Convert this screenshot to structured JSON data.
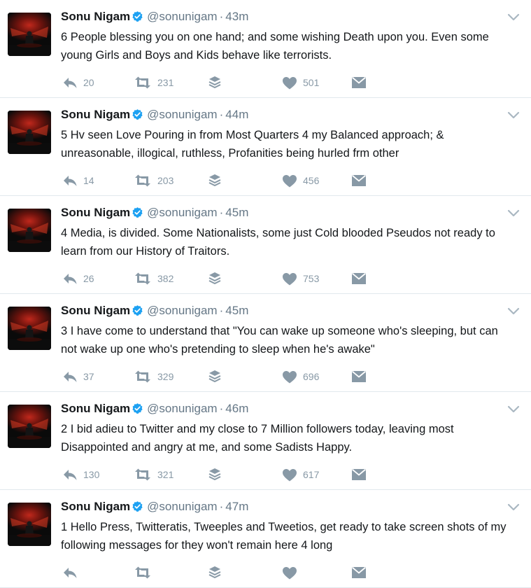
{
  "icons": {
    "avatar": "profile-photo",
    "verified": "verified-badge-icon",
    "caret": "chevron-down-icon",
    "reply": "reply-icon",
    "retweet": "retweet-icon",
    "stack": "layers-icon",
    "like": "heart-icon",
    "message": "envelope-icon"
  },
  "colors": {
    "verified": "#1da1f2",
    "action_gray": "#8899a6",
    "name": "#14171a",
    "meta": "#657786"
  },
  "tweets": [
    {
      "name": "Sonu Nigam",
      "handle": "@sonunigam",
      "sep": "·",
      "time": "43m",
      "text": "6 People blessing you on one hand; and some wishing Death upon you. Even some young Girls and Boys and Kids behave like terrorists.",
      "replies": "20",
      "retweets": "231",
      "likes": "501"
    },
    {
      "name": "Sonu Nigam",
      "handle": "@sonunigam",
      "sep": "·",
      "time": "44m",
      "text": "5 Hv seen Love Pouring in from Most Quarters 4 my Balanced approach; & unreasonable, illogical, ruthless, Profanities being hurled frm other",
      "replies": "14",
      "retweets": "203",
      "likes": "456"
    },
    {
      "name": "Sonu Nigam",
      "handle": "@sonunigam",
      "sep": "·",
      "time": "45m",
      "text": "4 Media, is divided. Some Nationalists, some just Cold blooded Pseudos not ready to learn from our History of Traitors.",
      "replies": "26",
      "retweets": "382",
      "likes": "753"
    },
    {
      "name": "Sonu Nigam",
      "handle": "@sonunigam",
      "sep": "·",
      "time": "45m",
      "text": "3 I have come to understand that \"You can wake up someone who's sleeping, but can not wake up one who's pretending to sleep when he's awake\"",
      "replies": "37",
      "retweets": "329",
      "likes": "696"
    },
    {
      "name": "Sonu Nigam",
      "handle": "@sonunigam",
      "sep": "·",
      "time": "46m",
      "text": "2 I bid adieu to Twitter and my close to 7 Million followers today, leaving most Disappointed and angry at me, and some Sadists Happy.",
      "replies": "130",
      "retweets": "321",
      "likes": "617"
    },
    {
      "name": "Sonu Nigam",
      "handle": "@sonunigam",
      "sep": "·",
      "time": "47m",
      "text": "1 Hello Press, Twitteratis, Tweeples and Tweetios, get ready to take screen shots of my following messages for they won't remain here 4 long",
      "replies": "",
      "retweets": "",
      "likes": ""
    }
  ]
}
